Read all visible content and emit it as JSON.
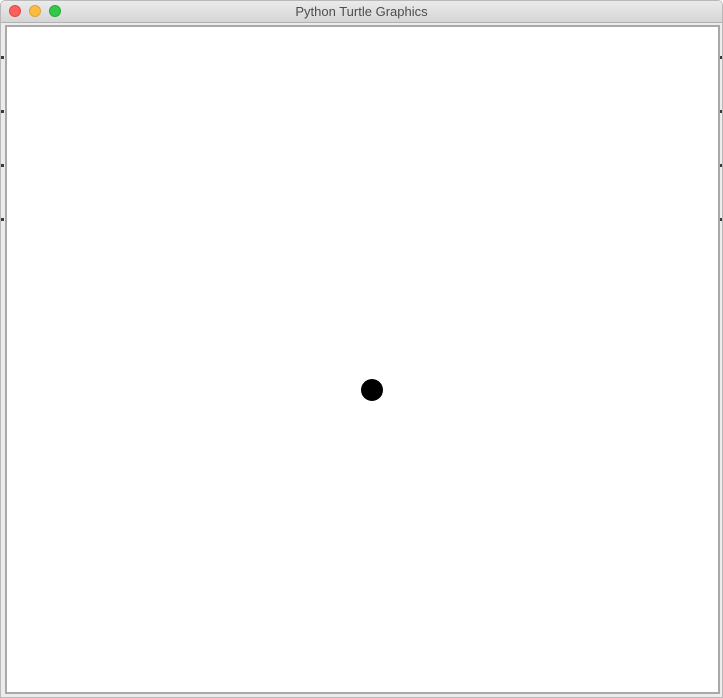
{
  "window": {
    "title": "Python Turtle Graphics",
    "buttons": {
      "close": "close",
      "minimize": "minimize",
      "zoom": "zoom"
    }
  },
  "canvas": {
    "background": "#ffffff",
    "dot_color": "#000000"
  },
  "colors": {
    "close": "#fc605c",
    "minimize": "#fdbc40",
    "zoom": "#34c84a",
    "titlebar": "#e2e2e2",
    "frame": "#a9a9a9"
  }
}
